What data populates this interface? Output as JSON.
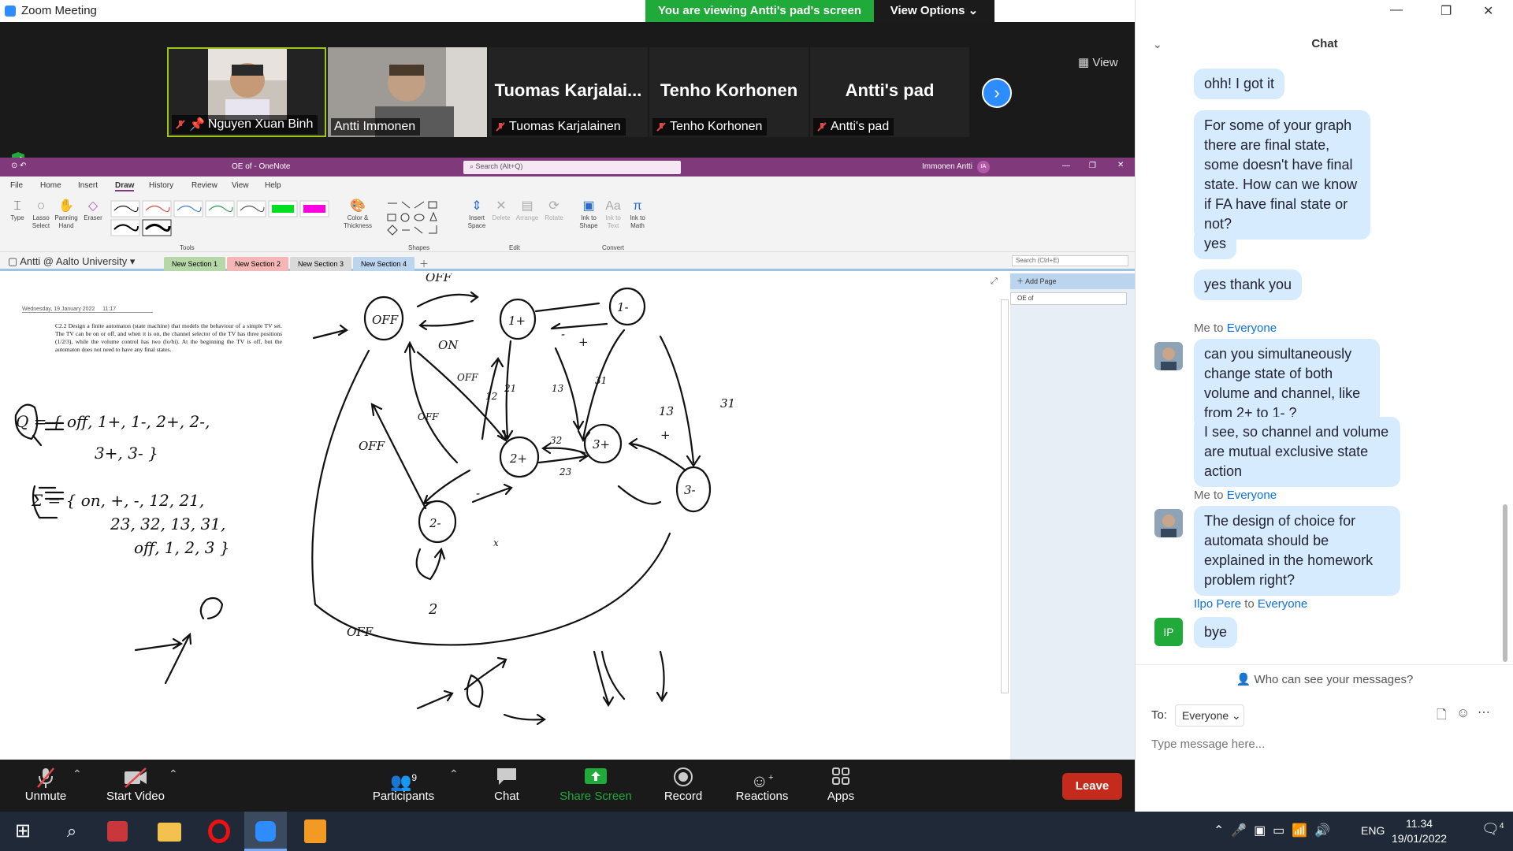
{
  "window": {
    "title": "Zoom Meeting"
  },
  "banner": {
    "text": "You are viewing Antti's pad's screen",
    "view_options": "View Options"
  },
  "participants": [
    {
      "name": "Nguyen Xuan Binh",
      "kind": "video"
    },
    {
      "name": "Antti Immonen",
      "kind": "video"
    },
    {
      "name": "Tuomas Karjalainen",
      "display": "Tuomas  Karjalai...",
      "kind": "name"
    },
    {
      "name": "Tenho Korhonen",
      "display": "Tenho Korhonen",
      "kind": "name"
    },
    {
      "name": "Antti's pad",
      "display": "Antti's pad",
      "kind": "name"
    }
  ],
  "strip": {
    "view_label": "View"
  },
  "onenote": {
    "doc_title": "OE of  -  OneNote",
    "search": "Search (Alt+Q)",
    "user": "Immonen Antti",
    "user_initials": "IA",
    "tabs": [
      "File",
      "Home",
      "Insert",
      "Draw",
      "History",
      "Review",
      "View",
      "Help"
    ],
    "active_tab": "Draw",
    "tools": [
      {
        "label": "Type"
      },
      {
        "label": "Lasso Select"
      },
      {
        "label": "Panning Hand"
      },
      {
        "label": "Eraser"
      },
      {
        "label": "Color & Thickness"
      },
      {
        "label": "Insert Space"
      },
      {
        "label": "Delete"
      },
      {
        "label": "Arrange"
      },
      {
        "label": "Rotate"
      },
      {
        "label": "Ink to Shape"
      },
      {
        "label": "Ink to Text"
      },
      {
        "label": "Ink to Math"
      }
    ],
    "groups": [
      "Tools",
      "Shapes",
      "Edit",
      "Convert"
    ],
    "notebook": "Antti @ Aalto University",
    "sections": [
      {
        "label": "New Section 1",
        "color": "#b6d7a8"
      },
      {
        "label": "New Section 2",
        "color": "#f4b6b6"
      },
      {
        "label": "New Section 3",
        "color": "#d9d9d9"
      },
      {
        "label": "New Section 4",
        "color": "#bcd5ee"
      }
    ],
    "search_page": "Search (Ctrl+E)",
    "add_page": "Add Page",
    "page_list": [
      "OE of"
    ],
    "page_date": "Wednesday, 19 January 2022",
    "page_time": "11:17",
    "problem_text": "C2.2 Design a finite automaton (state machine) that models the behaviour of a simple TV set. The TV can be on or off, and when it is on, the channel selector of the TV has three positions (1/2/3), while the volume control has two (lo/hi). At the beginning the TV is off, but the automaton does not need to have any final states."
  },
  "handwriting": {
    "Q": "Q = { off, 1+, 1-, 2+, 2-,",
    "Q2": "3+, 3- }",
    "sigma": "Σ = { on, +, -, 12, 21,",
    "sigma2": "23, 32, 13, 31,",
    "sigma3": "off, 1, 2, 3 }",
    "states": [
      "OFF",
      "1+",
      "1-",
      "2+",
      "2-",
      "3+",
      "3-"
    ],
    "edge_labels": [
      "OFF",
      "ON",
      "OFF",
      "OFF",
      "OFF",
      "12",
      "21",
      "13",
      "31",
      "32",
      "23",
      "13",
      "31",
      "+",
      "-",
      "+",
      "-",
      "2",
      "OFF",
      "x"
    ]
  },
  "toolbar": {
    "unmute": "Unmute",
    "start_video": "Start Video",
    "participants": "Participants",
    "participant_count": "9",
    "chat": "Chat",
    "share": "Share Screen",
    "record": "Record",
    "reactions": "Reactions",
    "apps": "Apps",
    "leave": "Leave"
  },
  "chat": {
    "title": "Chat",
    "messages": [
      {
        "text": "ohh! I got it"
      },
      {
        "text": "For some of your graph there are final state, some doesn't have final state. How can we know if FA have final state or not?"
      },
      {
        "text": "yes"
      },
      {
        "text": "yes thank you"
      },
      {
        "sender": "Me",
        "to": "Everyone",
        "text": "can you simultaneously change state of both volume and channel, like from 2+ to 1- ?"
      },
      {
        "text": "I see, so channel and volume are mutual exclusive state action"
      },
      {
        "sender": "Me",
        "to": "Everyone",
        "text": "The design of choice for automata should be explained in the homework problem right?"
      },
      {
        "sender": "Ilpo Pere",
        "to": "Everyone",
        "initials": "IP",
        "text": "bye"
      }
    ],
    "sender_joiner": "to",
    "privacy": "Who can see your messages?",
    "to_label": "To:",
    "to_value": "Everyone",
    "placeholder": "Type message here..."
  },
  "taskbar": {
    "lang": "ENG",
    "time": "11.34",
    "date": "19/01/2022",
    "notifications": "4"
  },
  "colors": {
    "zoom_blue": "#2d8cff",
    "onenote_purple": "#80397b",
    "banner_green": "#1faa39",
    "leave_red": "#c42b1c",
    "chat_bubble": "#d7ebff"
  }
}
